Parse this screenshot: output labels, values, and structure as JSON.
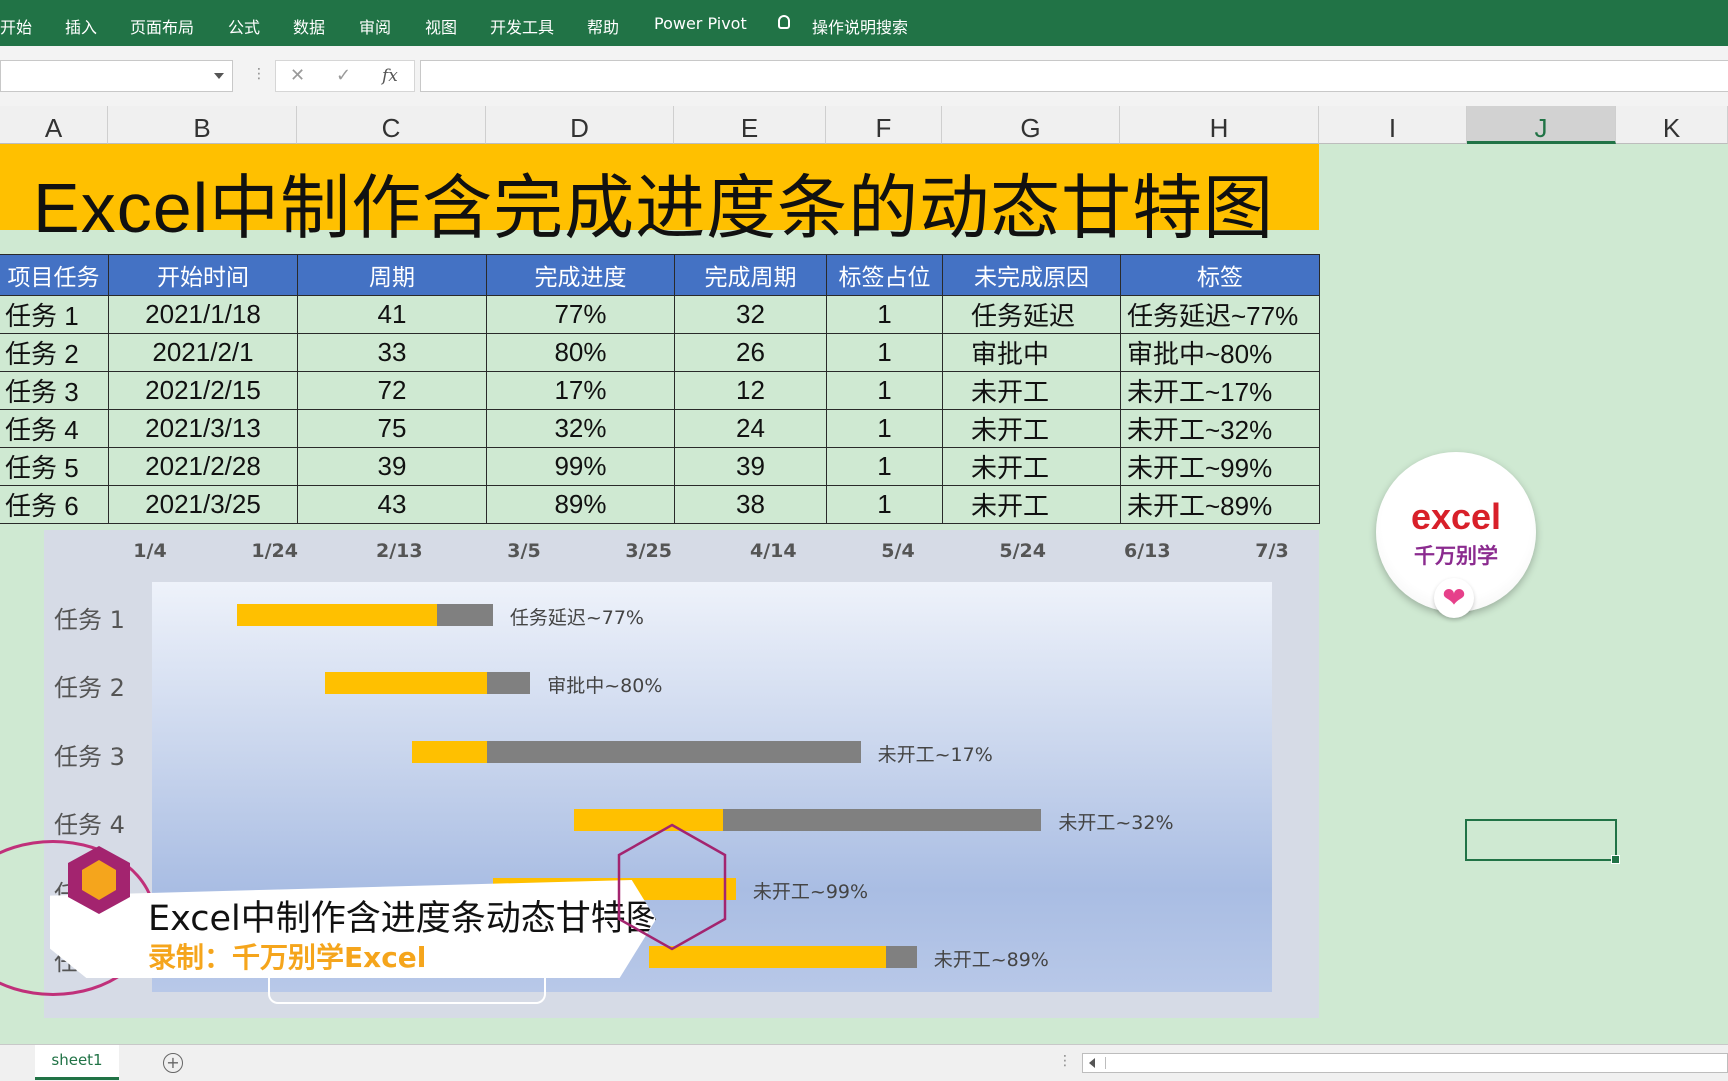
{
  "ribbon": {
    "tabs": [
      "开始",
      "插入",
      "页面布局",
      "公式",
      "数据",
      "审阅",
      "视图",
      "开发工具",
      "帮助",
      "Power Pivot"
    ],
    "search_label": "操作说明搜索",
    "color": "#217346"
  },
  "formula_bar": {
    "name_box": "",
    "cancel_icon": "✕",
    "enter_icon": "✓",
    "fx_label": "fx",
    "formula": ""
  },
  "columns": [
    "A",
    "B",
    "C",
    "D",
    "E",
    "F",
    "G",
    "H",
    "I",
    "J",
    "K"
  ],
  "selected_column": "J",
  "sheet_title": "Excel中制作含完成进度条的动态甘特图",
  "table": {
    "headers": [
      "项目任务",
      "开始时间",
      "周期",
      "完成进度",
      "完成周期",
      "标签占位",
      "未完成原因",
      "标签"
    ],
    "rows": [
      [
        "任务 1",
        "2021/1/18",
        "41",
        "77%",
        "32",
        "1",
        "任务延迟",
        "任务延迟~77%"
      ],
      [
        "任务 2",
        "2021/2/1",
        "33",
        "80%",
        "26",
        "1",
        "审批中",
        "审批中~80%"
      ],
      [
        "任务 3",
        "2021/2/15",
        "72",
        "17%",
        "12",
        "1",
        "未开工",
        "未开工~17%"
      ],
      [
        "任务 4",
        "2021/3/13",
        "75",
        "32%",
        "24",
        "1",
        "未开工",
        "未开工~32%"
      ],
      [
        "任务 5",
        "2021/2/28",
        "39",
        "99%",
        "39",
        "1",
        "未开工",
        "未开工~99%"
      ],
      [
        "任务 6",
        "2021/3/25",
        "43",
        "89%",
        "38",
        "1",
        "未开工",
        "未开工~89%"
      ]
    ]
  },
  "chart_data": {
    "type": "bar",
    "orientation": "horizontal",
    "x_ticks": [
      "1/4",
      "1/24",
      "2/13",
      "3/5",
      "3/25",
      "4/14",
      "5/4",
      "5/24",
      "6/13",
      "7/3"
    ],
    "xlim": [
      "2021-01-04",
      "2021-07-03"
    ],
    "categories": [
      "任务 1",
      "任务 2",
      "任务 3",
      "任务 4",
      "任务 5",
      "任务 6"
    ],
    "start": [
      "2021-01-18",
      "2021-02-01",
      "2021-02-15",
      "2021-03-13",
      "2021-02-28",
      "2021-03-25"
    ],
    "duration": [
      41,
      33,
      72,
      75,
      39,
      43
    ],
    "completed": [
      32,
      26,
      12,
      24,
      39,
      38
    ],
    "labels": [
      "任务延迟~77%",
      "审批中~80%",
      "未开工~17%",
      "未开工~32%",
      "未开工~99%",
      "未开工~89%"
    ],
    "colors": {
      "completed": "#ffc000",
      "remaining": "#808080"
    },
    "legend": "none",
    "grid": false
  },
  "badge": {
    "line1": "excel",
    "line2": "千万别学",
    "heart": "❤"
  },
  "overlay": {
    "line1": "Excel中制作含进度条动态甘特图",
    "line2": "录制：千万别学Excel"
  },
  "sheet_tabs": [
    "sheet1"
  ],
  "add_sheet": "+"
}
